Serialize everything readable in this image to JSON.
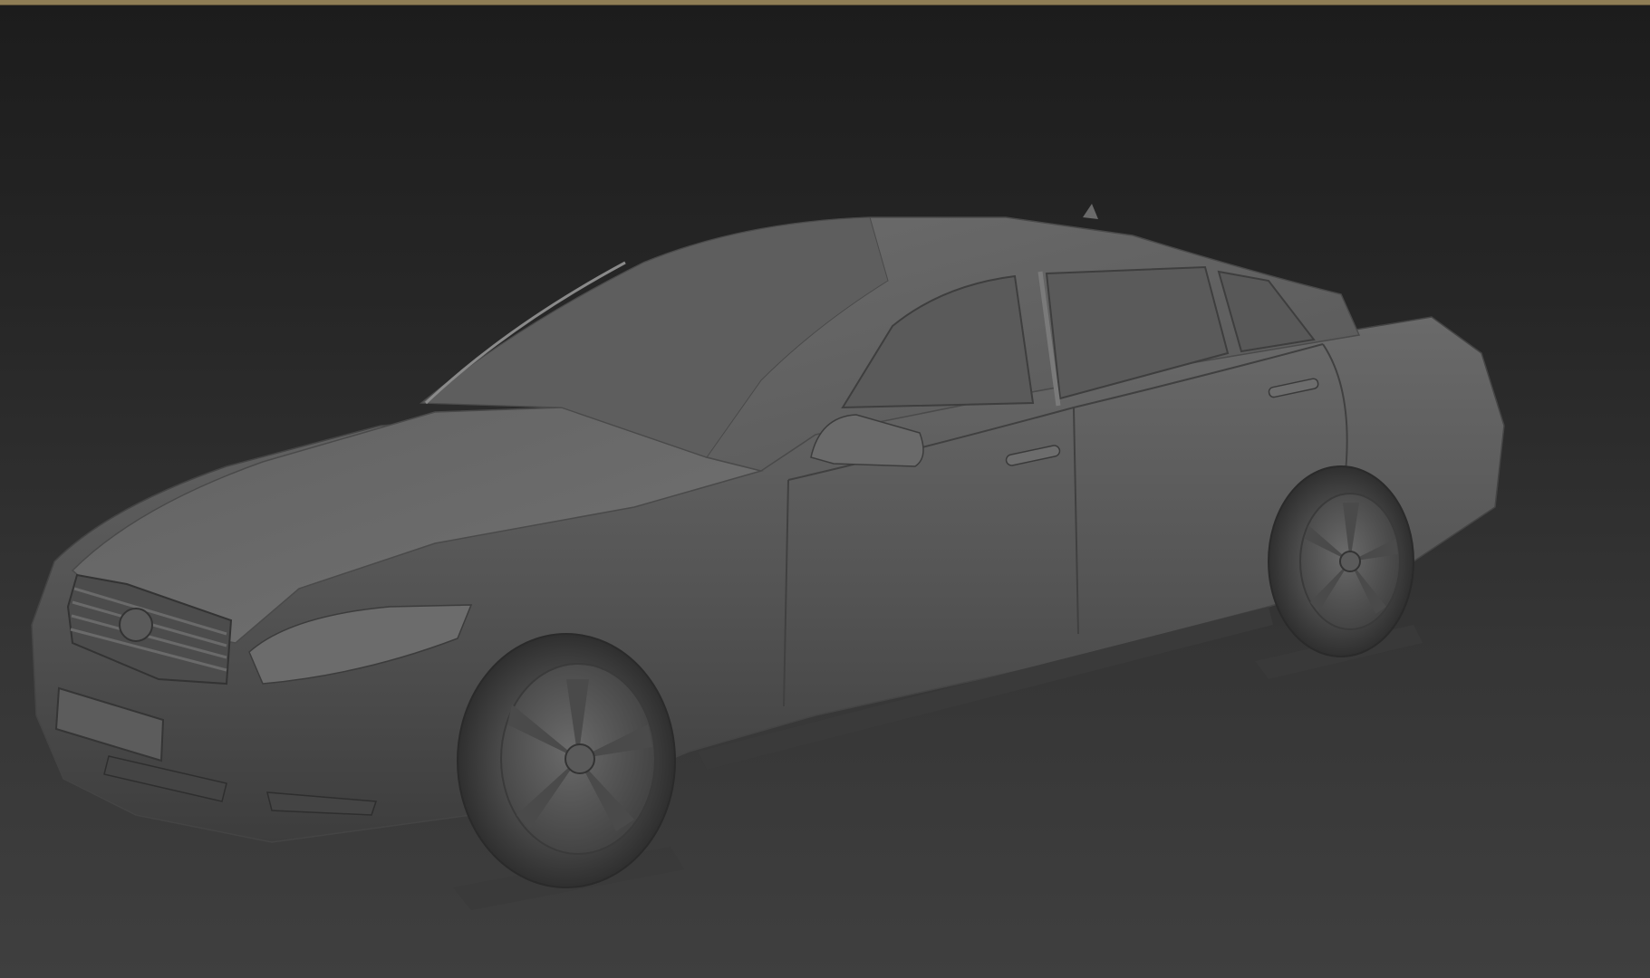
{
  "viewport": {
    "active_border_color": "#8f7d55",
    "background_top": "#1c1c1c",
    "background_bottom": "#3f3f3f",
    "shading_mode": "clay"
  },
  "model": {
    "object": "scanned-sedan-mesh",
    "base_color": "#5a5a5a",
    "highlight_color": "#7a7a7a",
    "shadow_color": "#2e2e2e"
  }
}
